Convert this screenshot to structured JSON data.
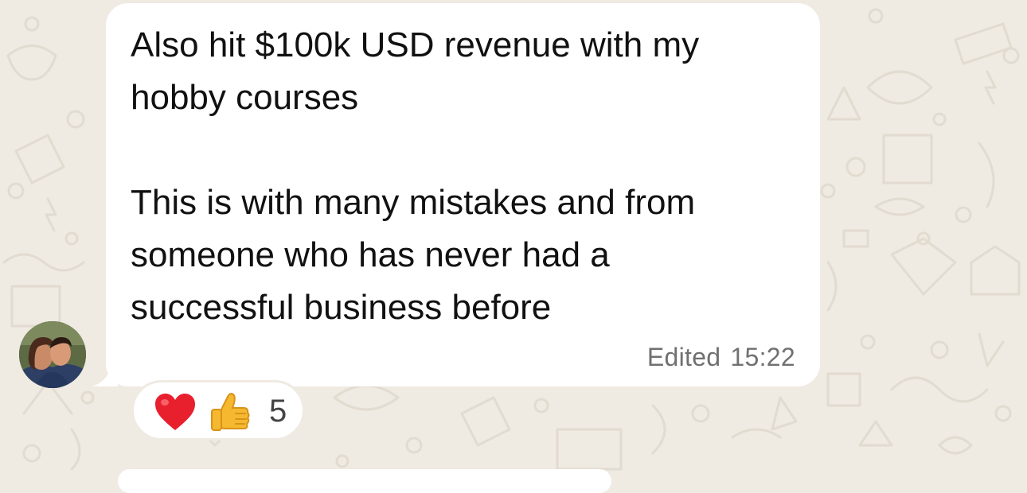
{
  "message": {
    "text": "Also hit $100k USD revenue with my\nhobby courses\n\nThis is with many mistakes and from\nsomeone who has never had a\nsuccessful business before",
    "edited_label": "Edited",
    "time": "15:22"
  },
  "reactions": {
    "icons": [
      "heart-icon",
      "thumbs-up-icon"
    ],
    "count": "5"
  },
  "sender": {
    "avatar_icon": "avatar"
  },
  "colors": {
    "chat_background": "#efeae2",
    "bubble": "#ffffff",
    "meta_text": "#707070",
    "heart": "#e8202e",
    "thumbs": "#f5b82e"
  }
}
